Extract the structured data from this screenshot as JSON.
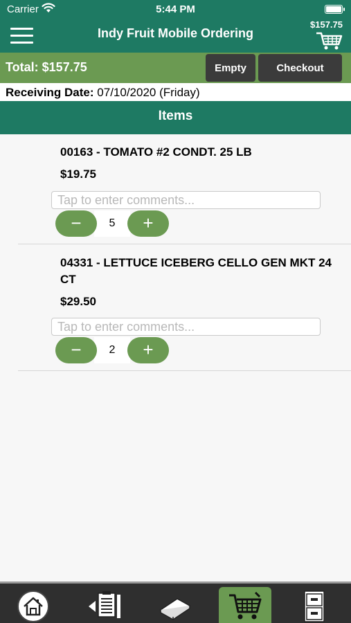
{
  "status_bar": {
    "carrier": "Carrier",
    "time": "5:44 PM"
  },
  "nav": {
    "title": "Indy Fruit Mobile Ordering",
    "cart_total": "$157.75"
  },
  "summary": {
    "total_label": "Total:  $157.75",
    "empty_label": "Empty",
    "checkout_label": "Checkout"
  },
  "receiving": {
    "label": "Receiving Date:",
    "value": "07/10/2020 (Friday)"
  },
  "items_header": "Items",
  "items": [
    {
      "title": "00163 - TOMATO #2 CONDT. 25 LB",
      "price": "$19.75",
      "comment_placeholder": "Tap to enter comments...",
      "quantity": "5",
      "minus": "−",
      "plus": "+"
    },
    {
      "title": "04331 - LETTUCE ICEBERG CELLO GEN MKT 24 CT",
      "price": "$29.50",
      "comment_placeholder": "Tap to enter comments...",
      "quantity": "2",
      "minus": "−",
      "plus": "+"
    }
  ],
  "tabs": [
    {
      "icon": "home-icon"
    },
    {
      "icon": "order-guide-icon"
    },
    {
      "icon": "catalog-book-icon"
    },
    {
      "icon": "cart-icon",
      "active": true
    },
    {
      "icon": "cabinet-icon"
    }
  ],
  "colors": {
    "brand_green": "#1e7a63",
    "accent_green": "#6b9a52",
    "dark_button": "#3b3b3b",
    "tab_bar": "#2f2f2f"
  }
}
